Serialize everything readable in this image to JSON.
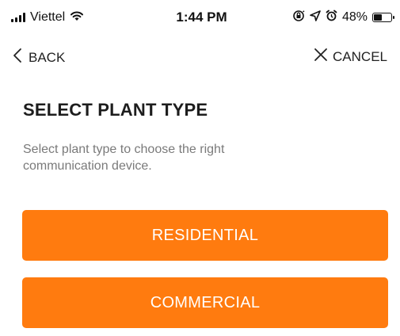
{
  "status_bar": {
    "carrier": "Viettel",
    "time": "1:44 PM",
    "battery_percent": "48%",
    "battery_level": 0.48,
    "icons": [
      "signal-icon",
      "wifi-icon",
      "screen-lock-icon",
      "location-icon",
      "alarm-icon",
      "battery-icon"
    ]
  },
  "nav": {
    "back_label": "BACK",
    "cancel_label": "CANCEL"
  },
  "content": {
    "title": "SELECT PLANT TYPE",
    "description": "Select plant type to choose the right communication device."
  },
  "options": {
    "residential_label": "RESIDENTIAL",
    "commercial_label": "COMMERCIAL"
  },
  "colors": {
    "accent": "#ff7b0f",
    "description_text": "#7a7a7a"
  }
}
